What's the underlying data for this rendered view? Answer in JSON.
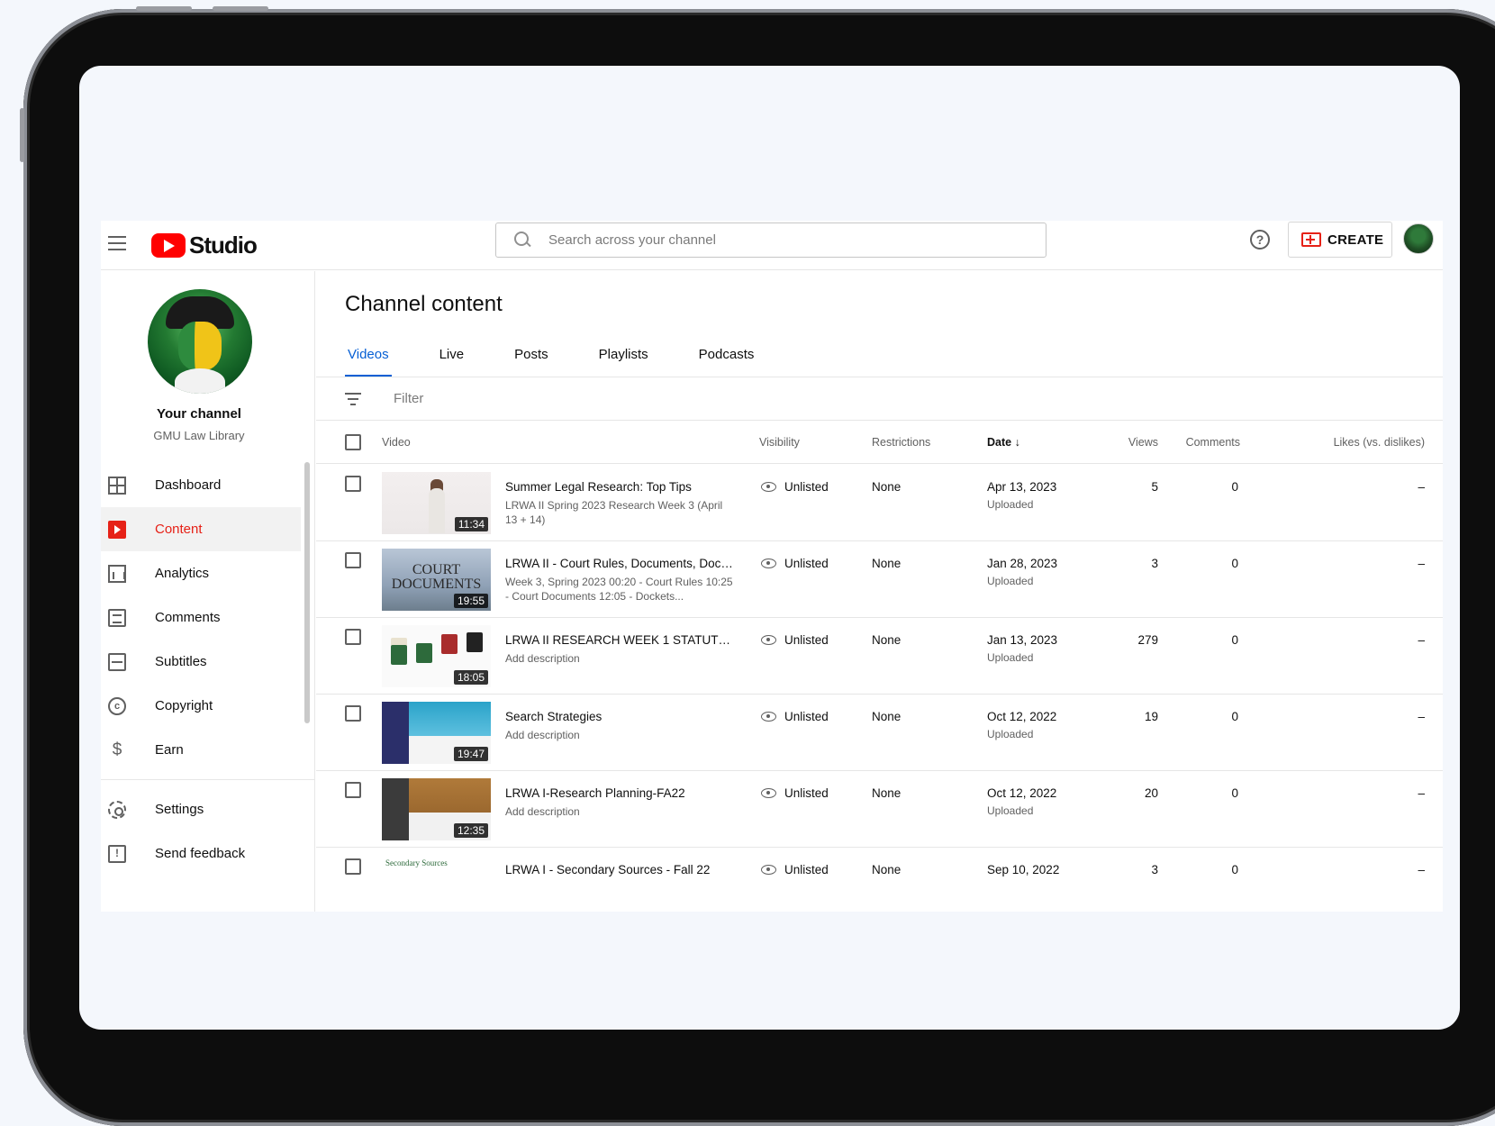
{
  "topbar": {
    "logo_text": "Studio",
    "search_placeholder": "Search across your channel",
    "help_label": "?",
    "create_label": "CREATE"
  },
  "sidebar": {
    "channel_title": "Your channel",
    "channel_name": "GMU Law Library",
    "items": [
      {
        "label": "Dashboard",
        "icon": "dashboard-icon"
      },
      {
        "label": "Content",
        "icon": "content-icon",
        "active": true
      },
      {
        "label": "Analytics",
        "icon": "analytics-icon"
      },
      {
        "label": "Comments",
        "icon": "comments-icon"
      },
      {
        "label": "Subtitles",
        "icon": "subtitles-icon"
      },
      {
        "label": "Copyright",
        "icon": "copyright-icon"
      },
      {
        "label": "Earn",
        "icon": "earn-icon"
      }
    ],
    "bottom_items": [
      {
        "label": "Settings",
        "icon": "settings-icon"
      },
      {
        "label": "Send feedback",
        "icon": "feedback-icon"
      }
    ]
  },
  "main": {
    "title": "Channel content",
    "tabs": [
      "Videos",
      "Live",
      "Posts",
      "Playlists",
      "Podcasts"
    ],
    "active_tab": "Videos",
    "filter_label": "Filter",
    "columns": {
      "video": "Video",
      "visibility": "Visibility",
      "restrictions": "Restrictions",
      "date": "Date",
      "views": "Views",
      "comments": "Comments",
      "likes": "Likes (vs. dislikes)"
    },
    "rows": [
      {
        "title": "Summer Legal Research: Top Tips",
        "description": "LRWA II Spring 2023 Research Week 3 (April 13 + 14)",
        "duration": "11:34",
        "visibility": "Unlisted",
        "restrictions": "None",
        "date": "Apr 13, 2023",
        "date_status": "Uploaded",
        "views": "5",
        "comments": "0",
        "likes": "–"
      },
      {
        "title": "LRWA II - Court Rules, Documents, Dock...",
        "description": "Week 3, Spring 2023 00:20 - Court Rules 10:25 - Court Documents 12:05 - Dockets...",
        "duration": "19:55",
        "thumb_text": "COURT DOCUMENTS",
        "visibility": "Unlisted",
        "restrictions": "None",
        "date": "Jan 28, 2023",
        "date_status": "Uploaded",
        "views": "3",
        "comments": "0",
        "likes": "–"
      },
      {
        "title": "LRWA II RESEARCH WEEK 1 STATUTES ...",
        "description": "Add description",
        "duration": "18:05",
        "visibility": "Unlisted",
        "restrictions": "None",
        "date": "Jan 13, 2023",
        "date_status": "Uploaded",
        "views": "279",
        "comments": "0",
        "likes": "–"
      },
      {
        "title": "Search Strategies",
        "description": "Add description",
        "duration": "19:47",
        "visibility": "Unlisted",
        "restrictions": "None",
        "date": "Oct 12, 2022",
        "date_status": "Uploaded",
        "views": "19",
        "comments": "0",
        "likes": "–"
      },
      {
        "title": "LRWA I-Research Planning-FA22",
        "description": "Add description",
        "duration": "12:35",
        "visibility": "Unlisted",
        "restrictions": "None",
        "date": "Oct 12, 2022",
        "date_status": "Uploaded",
        "views": "20",
        "comments": "0",
        "likes": "–"
      },
      {
        "title": "LRWA I - Secondary Sources - Fall 22",
        "description": "",
        "duration": "",
        "thumb_text": "Secondary Sources",
        "visibility": "Unlisted",
        "restrictions": "None",
        "date": "Sep 10, 2022",
        "date_status": "",
        "views": "3",
        "comments": "0",
        "likes": "–"
      }
    ]
  },
  "colors": {
    "brand_red": "#ff0000",
    "active_blue": "#065fd4",
    "active_nav_red": "#e62117"
  }
}
